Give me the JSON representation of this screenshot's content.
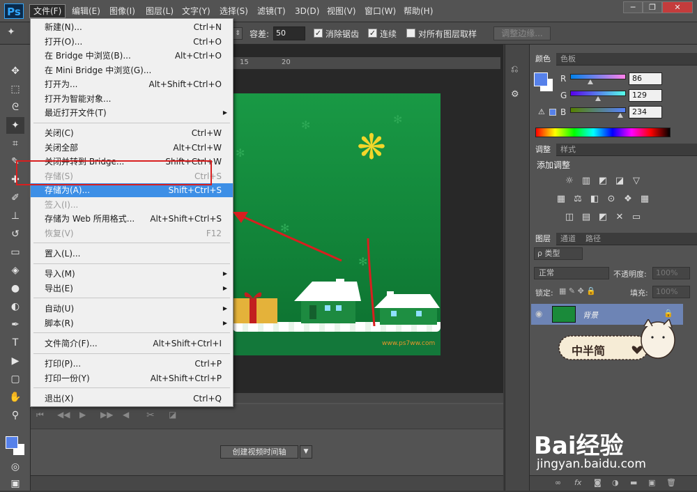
{
  "app": {
    "logo": "Ps"
  },
  "menubar": {
    "items": [
      "文件(F)",
      "编辑(E)",
      "图像(I)",
      "图层(L)",
      "文字(Y)",
      "选择(S)",
      "滤镜(T)",
      "3D(D)",
      "视图(V)",
      "窗口(W)",
      "帮助(H)"
    ]
  },
  "window": {
    "minimize": "─",
    "restore": "❐",
    "close": "✕"
  },
  "options": {
    "tolerance_label": "容差:",
    "tolerance_value": "50",
    "antialias_label": "消除锯齿",
    "contiguous_label": "连续",
    "all_layers_label": "对所有图层取样",
    "refine_edge": "调整边缘..."
  },
  "ruler": {
    "h": [
      "15",
      "20"
    ]
  },
  "file_menu": {
    "groups": [
      [
        {
          "label": "新建(N)...",
          "shortcut": "Ctrl+N"
        },
        {
          "label": "打开(O)...",
          "shortcut": "Ctrl+O"
        },
        {
          "label": "在 Bridge 中浏览(B)...",
          "shortcut": "Alt+Ctrl+O"
        },
        {
          "label": "在 Mini Bridge 中浏览(G)...",
          "shortcut": ""
        },
        {
          "label": "打开为...",
          "shortcut": "Alt+Shift+Ctrl+O"
        },
        {
          "label": "打开为智能对象...",
          "shortcut": ""
        },
        {
          "label": "最近打开文件(T)",
          "shortcut": ""
        }
      ],
      [
        {
          "label": "关闭(C)",
          "shortcut": "Ctrl+W"
        },
        {
          "label": "关闭全部",
          "shortcut": "Alt+Ctrl+W"
        },
        {
          "label": "关闭并转到 Bridge...",
          "shortcut": "Shift+Ctrl+W"
        },
        {
          "label": "存储(S)",
          "shortcut": "Ctrl+S"
        },
        {
          "label": "存储为(A)...",
          "shortcut": "Shift+Ctrl+S"
        },
        {
          "label": "签入(I)...",
          "shortcut": ""
        },
        {
          "label": "存储为 Web 所用格式...",
          "shortcut": "Alt+Shift+Ctrl+S"
        },
        {
          "label": "恢复(V)",
          "shortcut": "F12"
        }
      ],
      [
        {
          "label": "置入(L)...",
          "shortcut": ""
        }
      ],
      [
        {
          "label": "导入(M)",
          "shortcut": ""
        },
        {
          "label": "导出(E)",
          "shortcut": ""
        }
      ],
      [
        {
          "label": "自动(U)",
          "shortcut": ""
        },
        {
          "label": "脚本(R)",
          "shortcut": ""
        }
      ],
      [
        {
          "label": "文件简介(F)...",
          "shortcut": "Alt+Shift+Ctrl+I"
        }
      ],
      [
        {
          "label": "打印(P)...",
          "shortcut": "Ctrl+P"
        },
        {
          "label": "打印一份(Y)",
          "shortcut": "Alt+Shift+Ctrl+P"
        }
      ],
      [
        {
          "label": "退出(X)",
          "shortcut": "Ctrl+Q"
        }
      ]
    ]
  },
  "canvas": {
    "watermark": "www.ps7ww.com"
  },
  "timeline": {
    "create_button": "创建视频时间轴"
  },
  "color_panel": {
    "tabs": [
      "颜色",
      "色板"
    ],
    "r_label": "R",
    "r_value": "86",
    "g_label": "G",
    "g_value": "129",
    "b_label": "B",
    "b_value": "234",
    "fg": "#5681ea"
  },
  "adjust_panel": {
    "tabs": [
      "调整",
      "样式"
    ],
    "title": "添加调整"
  },
  "layers_panel": {
    "tabs": [
      "图层",
      "通道",
      "路径"
    ],
    "filter": "ρ 类型",
    "blend": "正常",
    "opacity_label": "不透明度:",
    "opacity_value": "100%",
    "lock_label": "锁定:",
    "fill_label": "填充:",
    "fill_value": "100%",
    "layer_name": "背景"
  },
  "sticker": {
    "text": "中半简"
  },
  "watermark": {
    "brand": "Bai经验",
    "url": "jingyan.baidu.com"
  }
}
